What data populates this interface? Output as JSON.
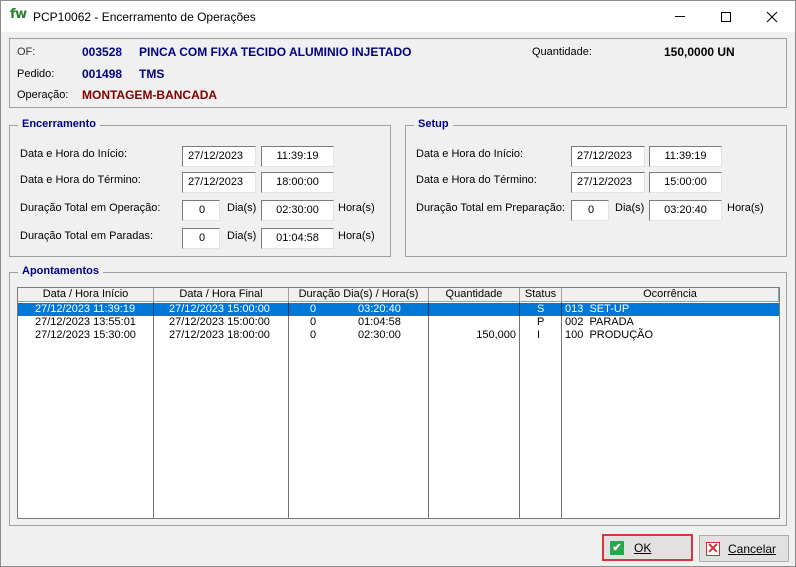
{
  "window": {
    "logo": "fw",
    "title": "PCP10062 - Encerramento de Operações"
  },
  "info": {
    "of_label": "OF:",
    "of_code": "003528",
    "of_desc": "PINCA COM FIXA TECIDO ALUMINIO INJETADO",
    "quantidade_label": "Quantidade:",
    "quantidade_value": "150,0000 UN",
    "pedido_label": "Pedido:",
    "pedido_code": "001498",
    "pedido_desc": "TMS",
    "operacao_label": "Operação:",
    "operacao_value": "MONTAGEM-BANCADA"
  },
  "encerramento": {
    "title": "Encerramento",
    "inicio_label": "Data e Hora do Início:",
    "inicio_date": "27/12/2023",
    "inicio_time": "11:39:19",
    "termino_label": "Data e Hora do Término:",
    "termino_date": "27/12/2023",
    "termino_time": "18:00:00",
    "operacao_label": "Duração Total em Operação:",
    "operacao_dias": "0",
    "operacao_dias_label": "Dia(s)",
    "operacao_horas": "02:30:00",
    "operacao_horas_label": "Hora(s)",
    "paradas_label": "Duração Total em Paradas:",
    "paradas_dias": "0",
    "paradas_dias_label": "Dia(s)",
    "paradas_horas": "01:04:58",
    "paradas_horas_label": "Hora(s)"
  },
  "setup": {
    "title": "Setup",
    "inicio_label": "Data e Hora do Início:",
    "inicio_date": "27/12/2023",
    "inicio_time": "11:39:19",
    "termino_label": "Data e Hora do Término:",
    "termino_date": "27/12/2023",
    "termino_time": "15:00:00",
    "preparacao_label": "Duração Total em Preparação:",
    "preparacao_dias": "0",
    "preparacao_dias_label": "Dia(s)",
    "preparacao_horas": "03:20:40",
    "preparacao_horas_label": "Hora(s)"
  },
  "apontamentos": {
    "title": "Apontamentos",
    "columns": [
      "Data / Hora Início",
      "Data / Hora Final",
      "Duração Dia(s) / Hora(s)",
      "Quantidade",
      "Status",
      "Ocorrência"
    ],
    "rows": [
      {
        "inicio": "27/12/2023 11:39:19",
        "final": "27/12/2023 15:00:00",
        "dias": "0",
        "horas": "03:20:40",
        "quantidade": "",
        "status": "S",
        "ocorrencia": "013  SET-UP"
      },
      {
        "inicio": "27/12/2023 13:55:01",
        "final": "27/12/2023 15:00:00",
        "dias": "0",
        "horas": "01:04:58",
        "quantidade": "",
        "status": "P",
        "ocorrencia": "002  PARADA"
      },
      {
        "inicio": "27/12/2023 15:30:00",
        "final": "27/12/2023 18:00:00",
        "dias": "0",
        "horas": "02:30:00",
        "quantidade": "150,000",
        "status": "I",
        "ocorrencia": "100  PRODUÇÃO"
      }
    ]
  },
  "buttons": {
    "ok": "OK",
    "cancel": "Cancelar"
  }
}
